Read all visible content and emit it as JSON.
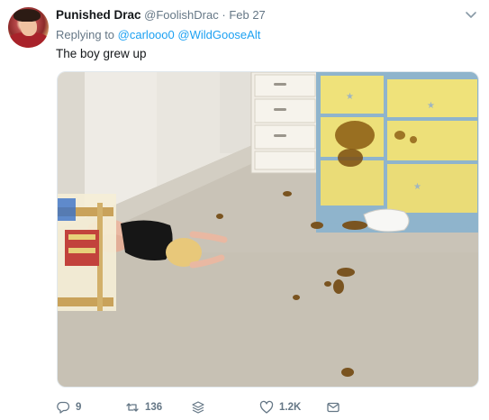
{
  "tweet": {
    "author_name": "Punished Drac",
    "author_handle": "@FoolishDrac",
    "separator": "·",
    "date": "Feb 27",
    "replying_prefix": "Replying to",
    "mentions": [
      "@carlooo0",
      "@WildGooseAlt"
    ],
    "text": "The boy grew up"
  },
  "actions": {
    "reply_count": "9",
    "retweet_count": "136",
    "like_count": "1.2K"
  },
  "icons": {
    "reply": "reply-icon",
    "retweet": "retweet-icon",
    "stack": "stack-icon",
    "like": "heart-icon",
    "message": "envelope-icon",
    "menu": "chevron-down-icon"
  },
  "colors": {
    "link": "#1da1f2",
    "muted": "#657786",
    "text": "#14171a"
  }
}
